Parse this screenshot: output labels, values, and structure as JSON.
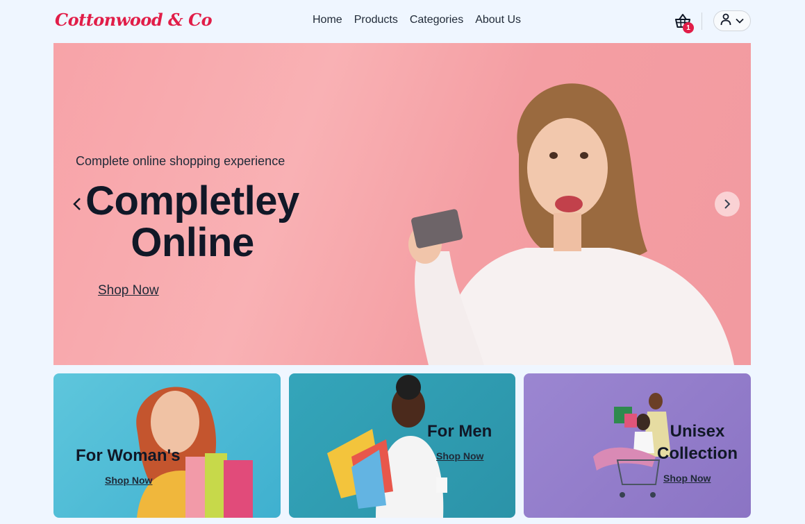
{
  "brand": {
    "logo_text": "Cottonwood & Co",
    "color": "#e11d48"
  },
  "nav": {
    "items": [
      "Home",
      "Products",
      "Categories",
      "About Us"
    ]
  },
  "header": {
    "cart_icon": "basket-icon",
    "cart_count": "1",
    "user_icon": "user-icon",
    "dropdown_icon": "chevron-down-icon"
  },
  "hero": {
    "subtitle": "Complete online shopping experience",
    "title": "Completley Online",
    "cta": "Shop Now",
    "prev_icon": "chevron-left-icon",
    "next_icon": "chevron-right-icon"
  },
  "cards": [
    {
      "title": "For Woman's",
      "cta": "Shop Now"
    },
    {
      "title": "For Men",
      "cta": "Shop Now"
    },
    {
      "title": "Unisex Collection",
      "cta": "Shop Now"
    }
  ]
}
